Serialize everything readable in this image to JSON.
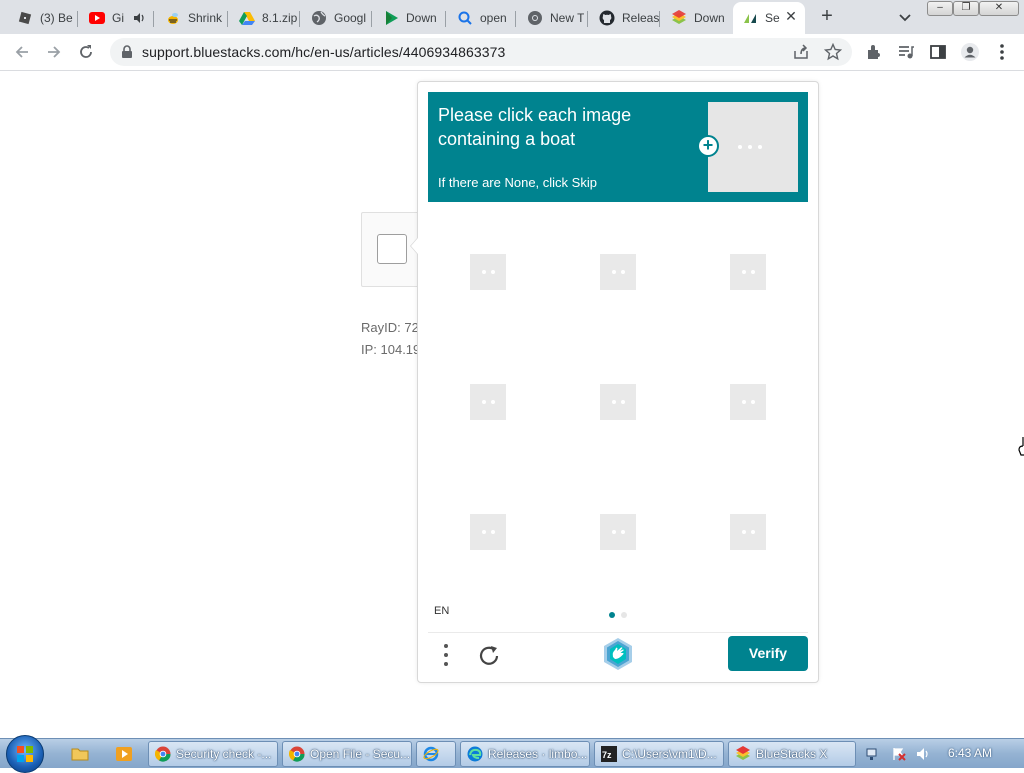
{
  "browser": {
    "tabs": [
      {
        "label": "(3) Be",
        "icon": "roblox-icon"
      },
      {
        "label": "Gi",
        "icon": "youtube-icon",
        "audio": true
      },
      {
        "label": "Shrink",
        "icon": "bee-icon"
      },
      {
        "label": "8.1.zip",
        "icon": "google-drive-icon"
      },
      {
        "label": "Googl",
        "icon": "globe-icon"
      },
      {
        "label": "Down",
        "icon": "play-icon"
      },
      {
        "label": "open",
        "icon": "search-icon"
      },
      {
        "label": "New T",
        "icon": "chrome-icon"
      },
      {
        "label": "Releas",
        "icon": "github-icon"
      },
      {
        "label": "Down",
        "icon": "bluestacks-icon"
      },
      {
        "label": "Se",
        "icon": "zendesk-icon",
        "active": true
      }
    ],
    "new_tab": "+",
    "url": "support.bluestacks.com/hc/en-us/articles/4406934863373",
    "window_controls": {
      "minimize": "–",
      "restore": "❐",
      "close": "✕"
    }
  },
  "page": {
    "ray_id": "RayID: 72",
    "ip": "IP: 104.19"
  },
  "captcha": {
    "title": "Please click each image containing a boat",
    "subtitle": "If there are None, click Skip",
    "language": "EN",
    "verify_label": "Verify",
    "accent": "#00838f",
    "pages": [
      true,
      false
    ],
    "grid_count": 9
  },
  "taskbar": {
    "tasks": [
      {
        "label": "Security check -...",
        "icon": "chrome-icon"
      },
      {
        "label": "Open File - Secu...",
        "icon": "chrome-icon"
      },
      {
        "label": "",
        "icon": "ie-icon"
      },
      {
        "label": "Releases · limbo...",
        "icon": "edge-icon"
      },
      {
        "label": "C:\\Users\\vm1\\D...",
        "icon": "7zip-icon"
      },
      {
        "label": "BlueStacks X",
        "icon": "bluestacks-icon"
      }
    ],
    "clock": "6:43 AM"
  }
}
